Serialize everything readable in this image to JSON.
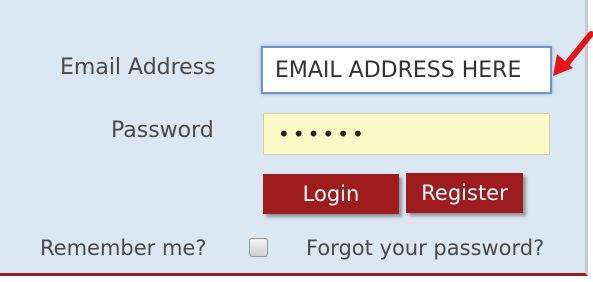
{
  "form": {
    "email": {
      "label": "Email Address",
      "value": "EMAIL ADDRESS HERE"
    },
    "password": {
      "label": "Password",
      "value": "••••••"
    },
    "buttons": {
      "login": "Login",
      "register": "Register"
    },
    "remember": {
      "label": "Remember me?",
      "checked": false
    },
    "forgot_password": "Forgot your password?"
  },
  "annotation": {
    "icon": "red-arrow-icon",
    "color": "#e8141c"
  },
  "colors": {
    "panel_background": "#dbe7f3",
    "button_background": "#9e1b1e",
    "password_background": "#fbfbc8"
  }
}
